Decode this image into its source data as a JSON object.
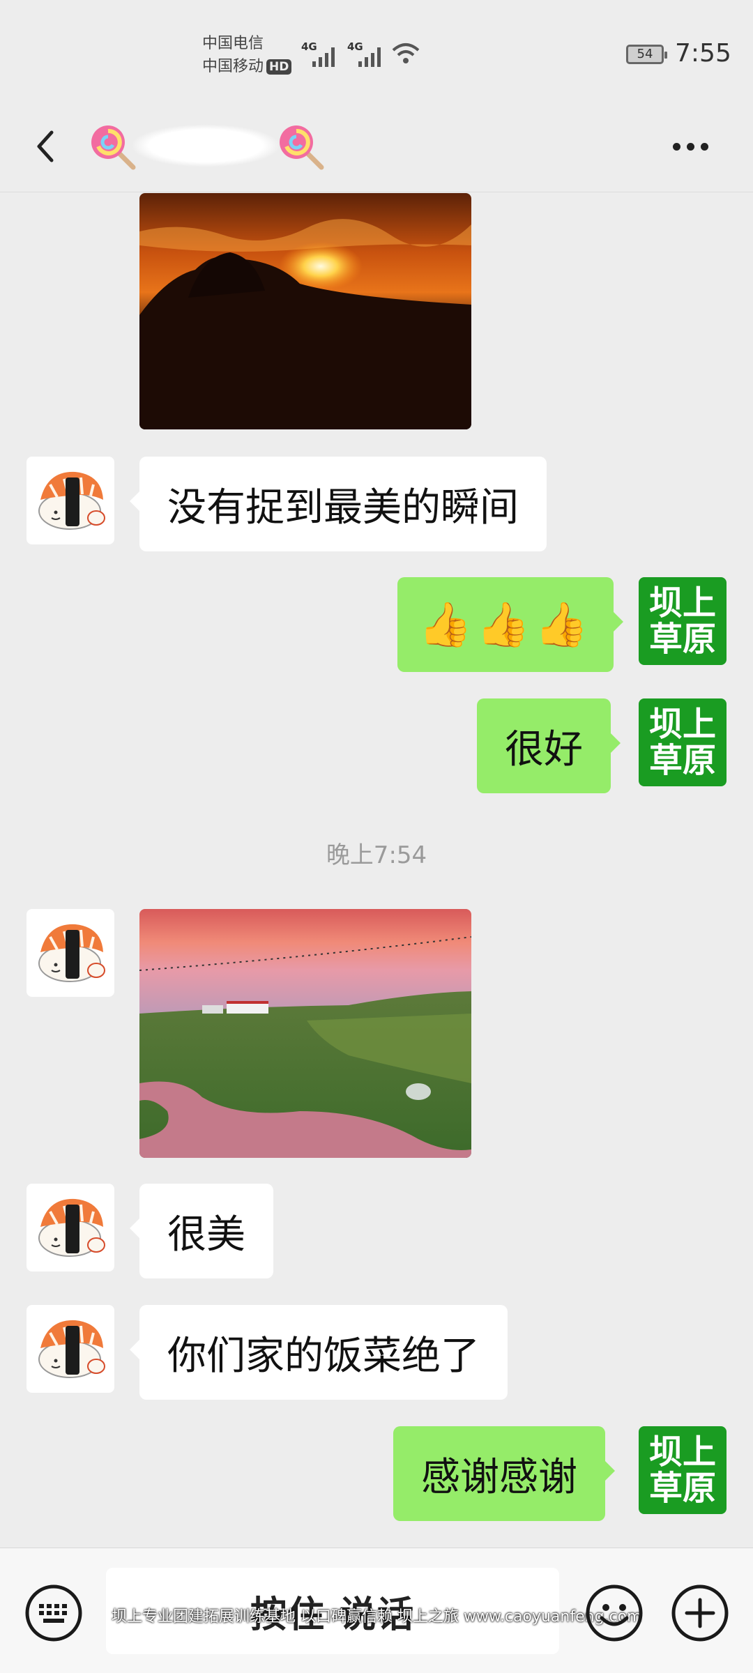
{
  "status_bar": {
    "carrier_1": "中国电信",
    "carrier_2": "中国移动",
    "hd_badge": "HD",
    "network_1": "4G",
    "network_2": "4G",
    "battery_level": "54",
    "time": "7:55"
  },
  "header": {
    "title_emoji": "🍭",
    "back_icon": "chevron-left-icon",
    "more_icon": "more-dots-icon"
  },
  "messages": {
    "m1_text": "没有捉到最美的瞬间",
    "m2_text": "👍👍👍",
    "m3_text": "很好",
    "timestamp": "晚上7:54",
    "m5_text": "很美",
    "m6_text": "你们家的饭菜绝了",
    "m7_text": "感谢感谢"
  },
  "self_avatar": {
    "line1": "坝上",
    "line2": "草原"
  },
  "input_bar": {
    "hold_to_talk": "按住 说话",
    "watermark": "坝上专业团建拓展训练基地 以口碑赢信赖 坝上之旅 www.caoyuanfeng.com"
  },
  "colors": {
    "background": "#ededed",
    "sent_bubble": "#95ec69",
    "received_bubble": "#ffffff",
    "self_avatar_bg": "#1a9c22"
  }
}
